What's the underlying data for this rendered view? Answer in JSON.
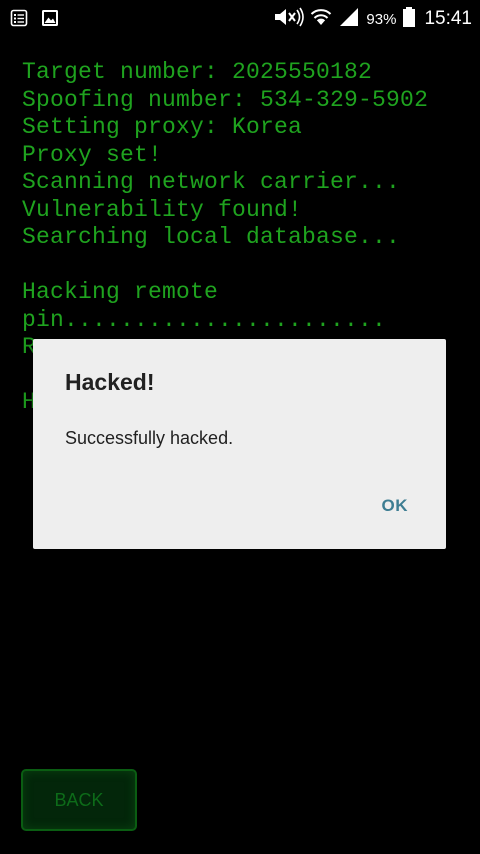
{
  "status_bar": {
    "left_icons": [
      "notes-icon",
      "gallery-icon"
    ],
    "right_icons": [
      "mute-icon",
      "wifi-icon",
      "signal-icon",
      "battery-icon"
    ],
    "battery_percent": "93%",
    "battery_level": 0.93,
    "time": "15:41"
  },
  "terminal": {
    "lines": [
      "Target number: 2025550182",
      "Spoofing number: 534-329-5902",
      "Setting proxy: Korea",
      "Proxy set!",
      "Scanning network carrier...",
      "Vulnerability found!",
      "Searching local database...",
      "",
      "Hacking remote",
      "pin.......................",
      "R",
      "",
      "H"
    ],
    "color": "#1fa31f"
  },
  "dialog": {
    "title": "Hacked!",
    "message": "Successfully hacked.",
    "ok_label": "OK"
  },
  "back_button": {
    "label": "BACK"
  },
  "colors": {
    "background": "#000000",
    "dialog_bg": "#eeeeee",
    "accent": "#3d7d92",
    "button_text": "#0d6b19"
  }
}
